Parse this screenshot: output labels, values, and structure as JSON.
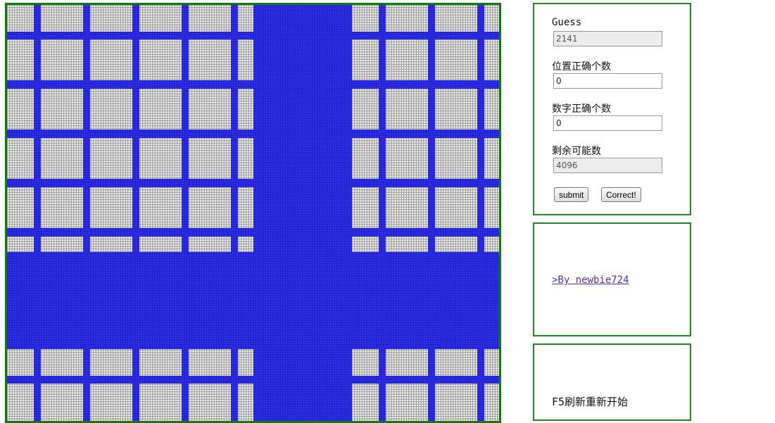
{
  "board": {
    "colors": {
      "hole": "#f4f4f4",
      "grid": "#8a8a8a",
      "fill": "#2323d8"
    }
  },
  "form": {
    "guess": {
      "label": "Guess",
      "value": "2141"
    },
    "position_correct": {
      "label": "位置正确个数",
      "value": "0"
    },
    "digit_correct": {
      "label": "数字正确个数",
      "value": "0"
    },
    "remaining": {
      "label": "剩余可能数",
      "value": "4096"
    },
    "submit_label": "submit",
    "correct_label": "Correct!"
  },
  "credit": {
    "text": ">By newbie724"
  },
  "help": {
    "text": "F5刷新重新开始"
  }
}
